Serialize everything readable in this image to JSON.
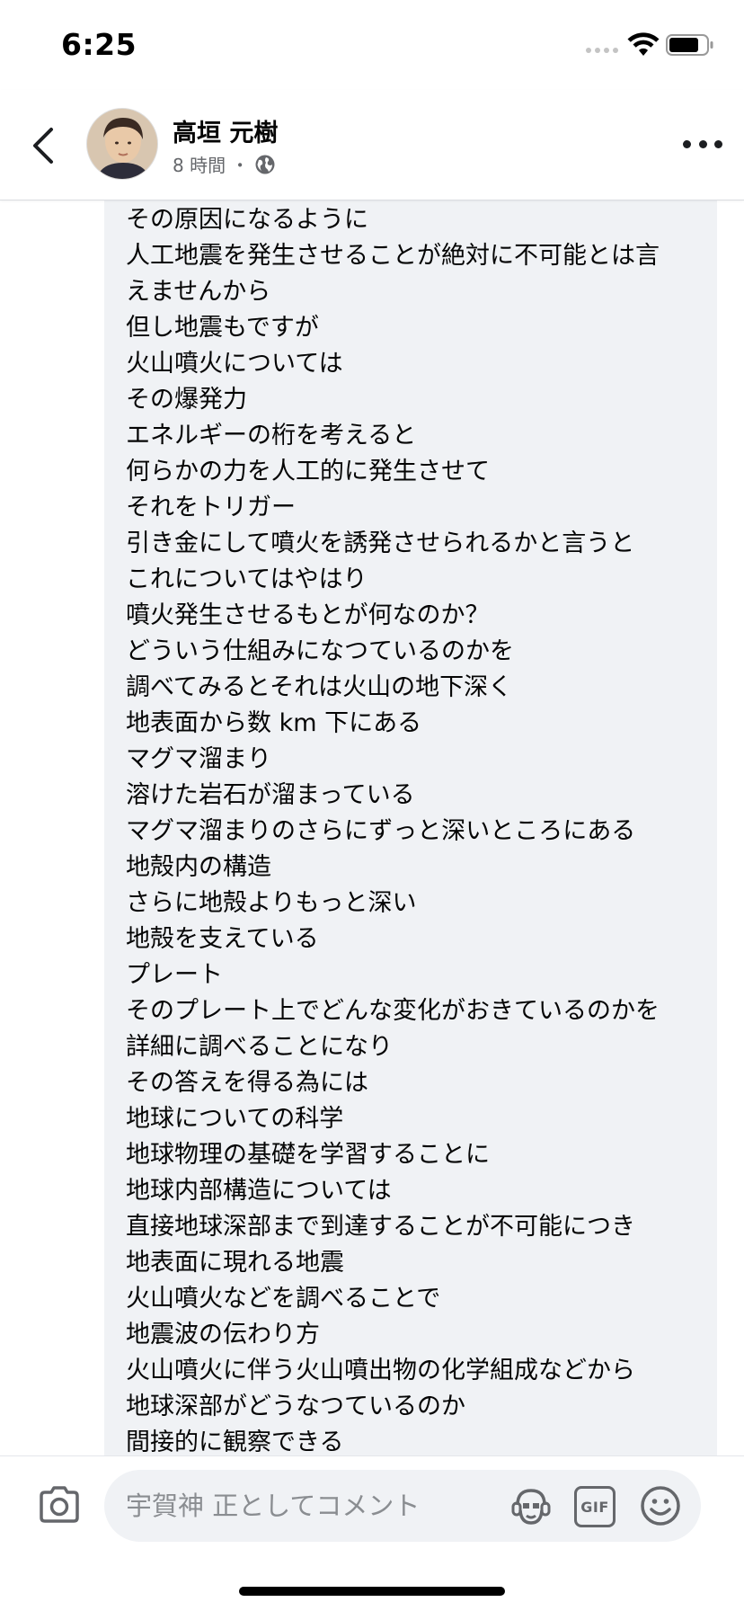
{
  "status_bar": {
    "time": "6:25"
  },
  "header": {
    "author_name": "高垣 元樹",
    "post_time": "8 時間",
    "separator": "・",
    "privacy_icon": "globe-icon"
  },
  "comment": {
    "lines": [
      "その原因になるように",
      "人工地震を発生させることが絶対に不可能とは言",
      "えませんから",
      "但し地震もですが",
      "火山噴火については",
      "その爆発力",
      "エネルギーの桁を考えると",
      "何らかの力を人工的に発生させて",
      "それをトリガー",
      "引き金にして噴火を誘発させられるかと言うと",
      "これについてはやはり",
      "噴火発生させるもとが何なのか？",
      "どういう仕組みになつているのかを",
      "調べてみるとそれは火山の地下深く",
      "地表面から数 km 下にある",
      "マグマ溜まり",
      "溶けた岩石が溜まっている",
      "マグマ溜まりのさらにずっと深いところにある",
      "地殻内の構造",
      "さらに地殻よりもっと深い",
      "地殻を支えている",
      "プレート",
      "そのプレート上でどんな変化がおきているのかを",
      "詳細に調べることになり",
      "その答えを得る為には",
      "地球についての科学",
      "地球物理の基礎を学習することに",
      "地球内部構造については",
      "直接地球深部まで到達することが不可能につき",
      "地表面に現れる地震",
      "火山噴火などを調べることで",
      "地震波の伝わり方",
      "火山噴火に伴う火山噴出物の化学組成などから",
      "地球深部がどうなつているのか",
      "間接的に観察できる"
    ]
  },
  "composer": {
    "placeholder": "宇賀神 正としてコメント",
    "gif_label": "GIF"
  },
  "colors": {
    "bubble": "#f0f2f5",
    "text": "#050505",
    "secondary_text": "#65676b"
  }
}
